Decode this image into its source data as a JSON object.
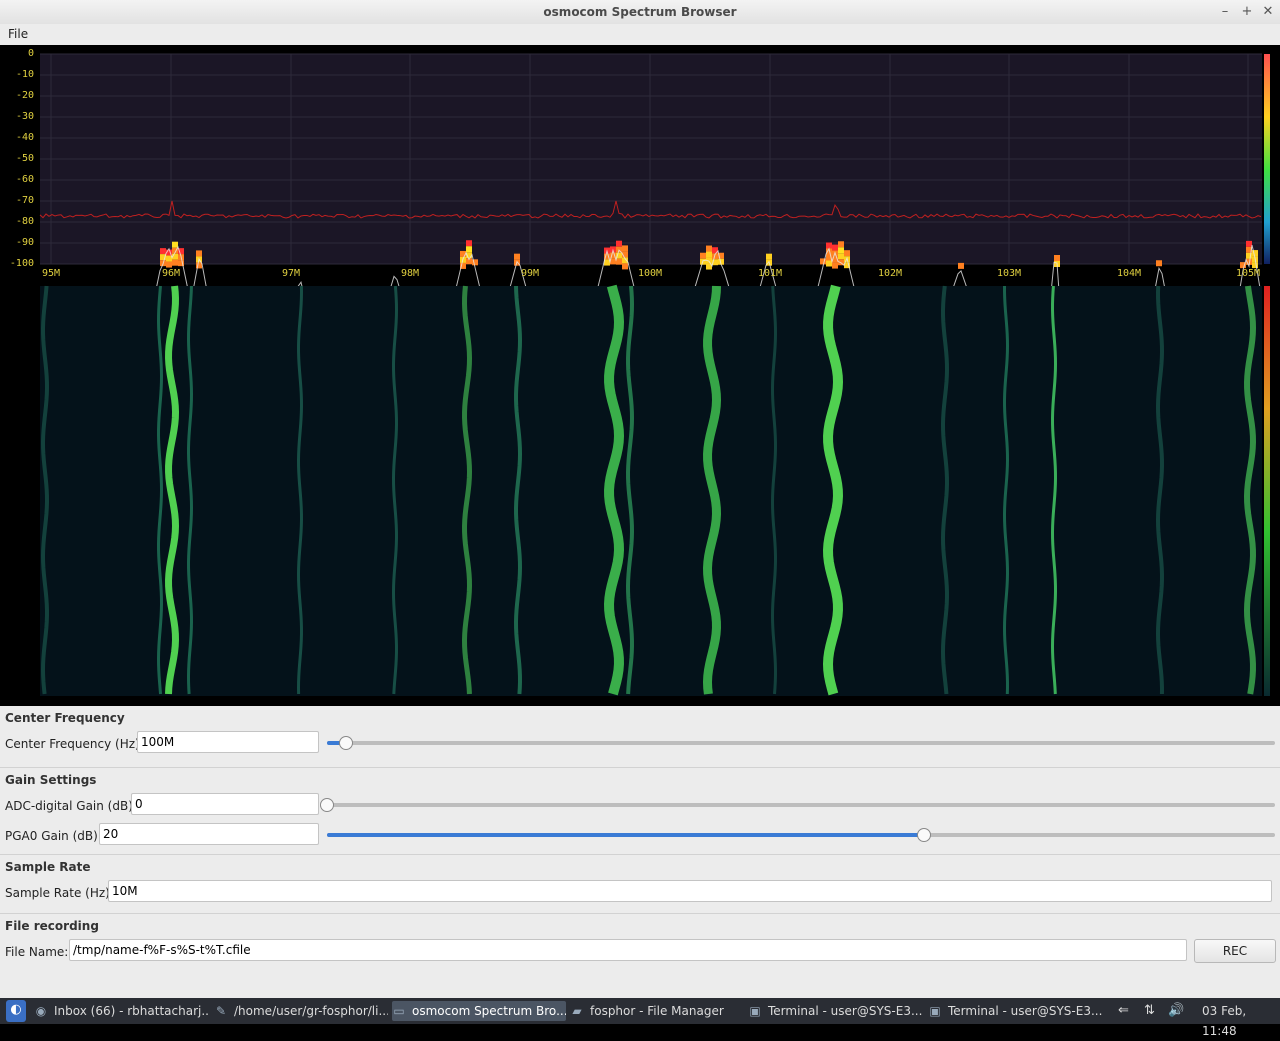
{
  "window": {
    "title": "osmocom Spectrum Browser"
  },
  "menu": {
    "file": "File"
  },
  "spectrum": {
    "y_ticks": [
      "0",
      "-10",
      "-20",
      "-30",
      "-40",
      "-50",
      "-60",
      "-70",
      "-80",
      "-90",
      "-100"
    ],
    "x_ticks": [
      "95M",
      "96M",
      "97M",
      "98M",
      "99M",
      "100M",
      "101M",
      "102M",
      "103M",
      "104M",
      "105M"
    ],
    "colors": {
      "label": "#e0d040",
      "peak_hold": "#c02020",
      "trace": "#e8e8e8"
    }
  },
  "center_frequency": {
    "section": "Center Frequency",
    "label": "Center Frequency (Hz):",
    "value": "100M",
    "slider_level": 0.02
  },
  "gain": {
    "section": "Gain Settings",
    "adc_label": "ADC-digital Gain (dB):",
    "adc_value": "0",
    "adc_level": 0.0,
    "pga_label": "PGA0 Gain (dB):",
    "pga_value": "20",
    "pga_level": 0.63
  },
  "sample_rate": {
    "section": "Sample Rate",
    "label": "Sample Rate (Hz):",
    "value": "10M"
  },
  "recording": {
    "section": "File recording",
    "label": "File Name:",
    "value": "/tmp/name-f%F-s%S-t%T.cfile",
    "rec_button": "REC"
  },
  "taskbar": {
    "tasks": [
      {
        "label": "Inbox (66) - rbhattacharj...",
        "icon": "chrome-icon"
      },
      {
        "label": "/home/user/gr-fosphor/li...",
        "icon": "editor-icon"
      },
      {
        "label": "osmocom Spectrum Bro...",
        "icon": "window-icon"
      },
      {
        "label": "fosphor - File Manager",
        "icon": "folder-icon"
      },
      {
        "label": "Terminal - user@SYS-E3...",
        "icon": "terminal-icon"
      },
      {
        "label": "Terminal - user@SYS-E3...",
        "icon": "terminal-icon"
      }
    ],
    "clock": "03 Feb, 11:48"
  }
}
